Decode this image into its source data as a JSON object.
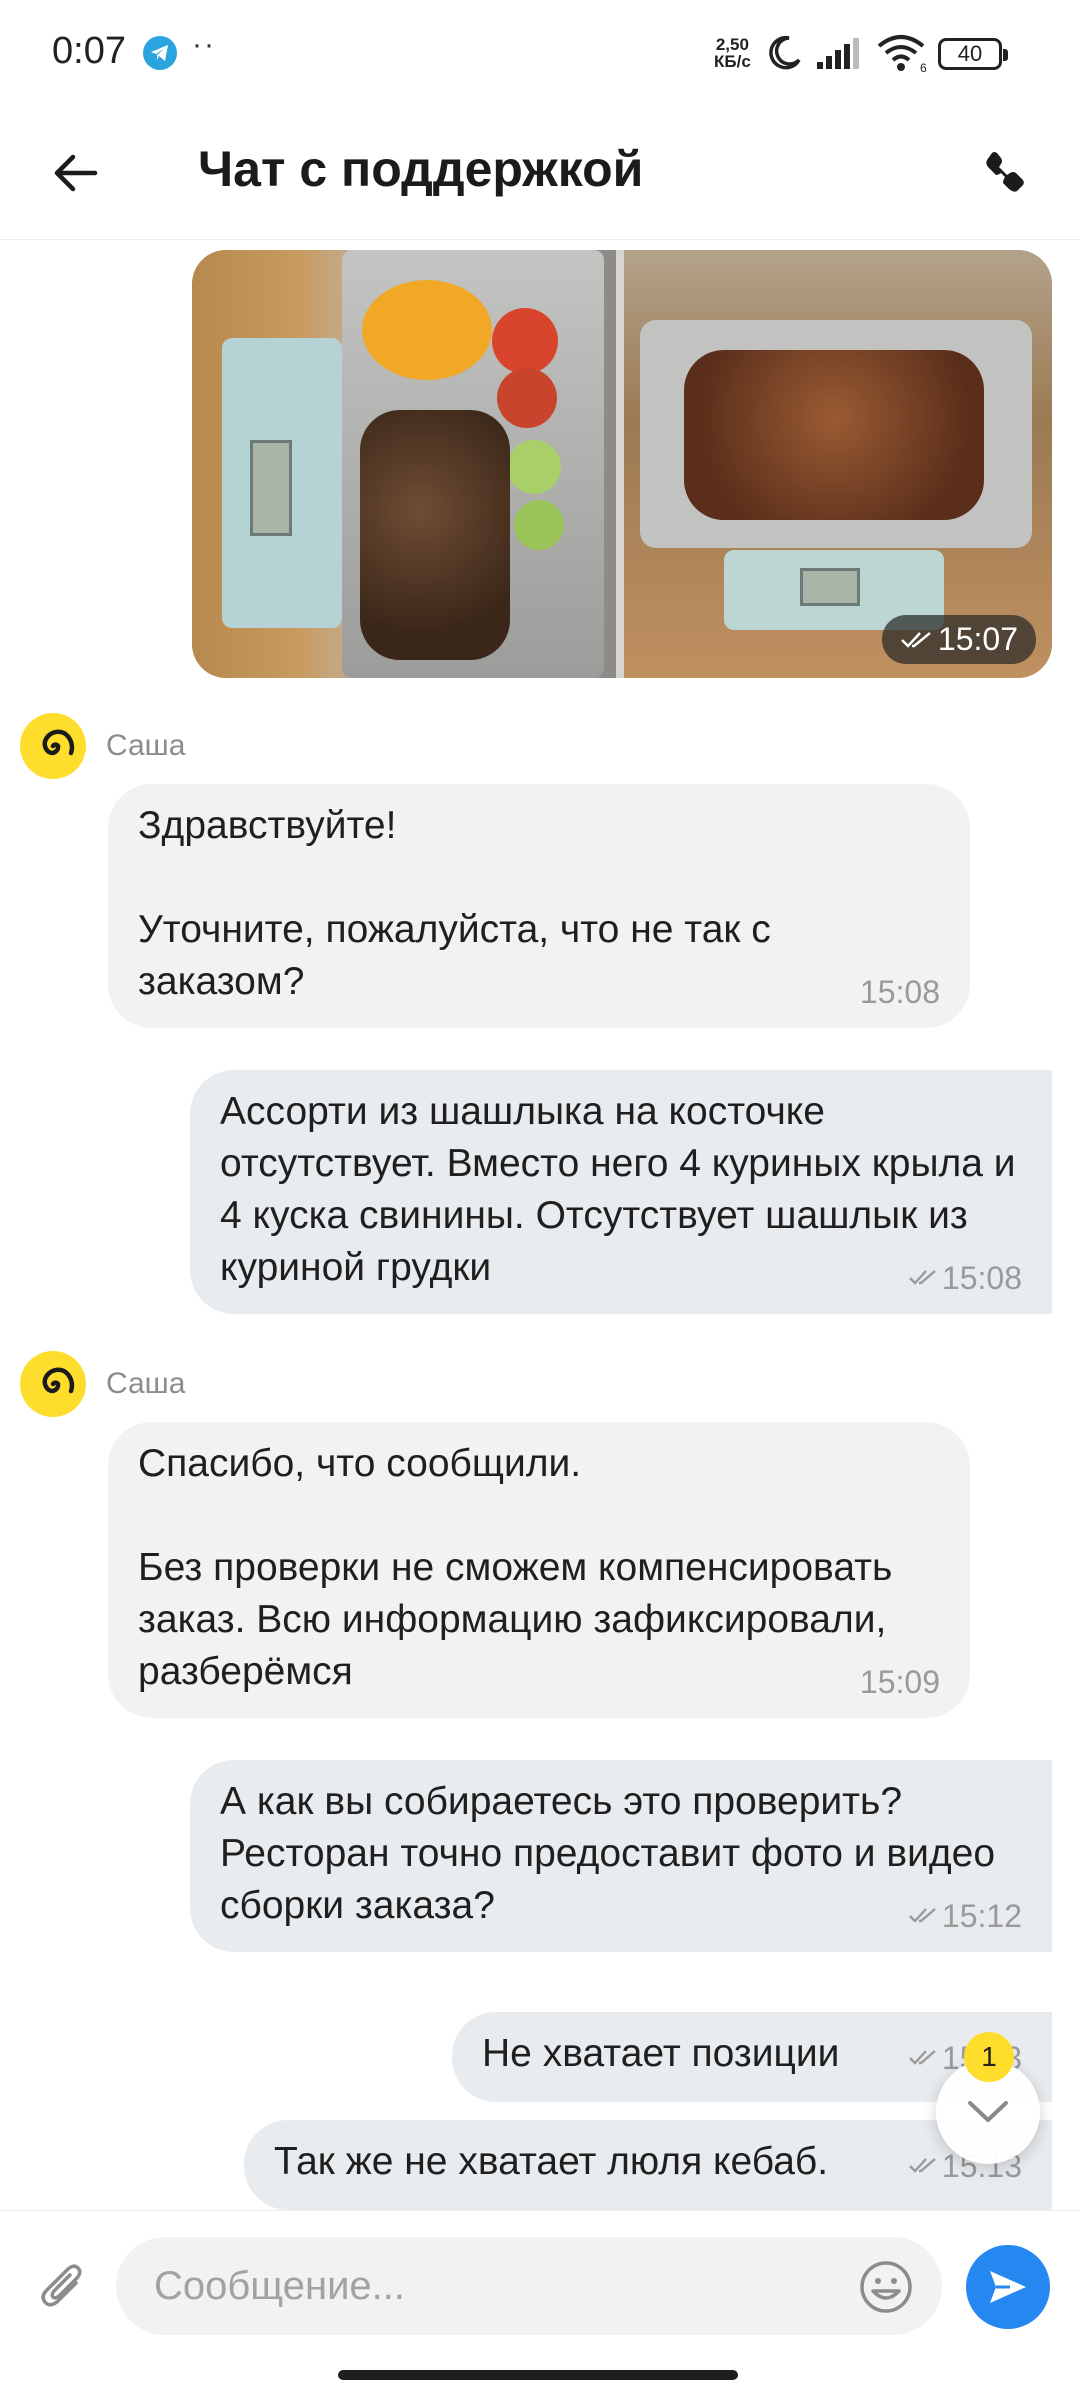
{
  "status_bar": {
    "time": "0:07",
    "dots": "··",
    "net_speed_value": "2,50",
    "net_speed_unit": "КБ/с",
    "battery": "40",
    "wifi_level": "6"
  },
  "header": {
    "title": "Чат с поддержкой"
  },
  "photo_message": {
    "time": "15:07",
    "left_scale_reading": "229",
    "right_scale_reading": "534"
  },
  "messages": [
    {
      "direction": "in",
      "sender": "Саша",
      "text": "Здравствуйте!\n\nУточните, пожалуйста, что не так с заказом?",
      "time": "15:08"
    },
    {
      "direction": "out",
      "text": "Ассорти из шашлыка на косточке отсутствует. Вместо него 4 куриных крыла и 4 куска свинины. Отсутствует шашлык из куриной грудки",
      "time": "15:08"
    },
    {
      "direction": "in",
      "sender": "Саша",
      "text": "Спасибо, что сообщили.\n\nБез проверки не сможем компенсировать заказ. Всю информацию зафиксировали, разберёмся",
      "time": "15:09"
    },
    {
      "direction": "out",
      "text": "А как вы собираетесь это проверить? Ресторан точно предоставит фото и видео сборки заказа?",
      "time": "15:12"
    },
    {
      "direction": "out",
      "text": "Не хватает позиции",
      "time": "15:13"
    },
    {
      "direction": "out",
      "text": "Так же не хватает люля кебаб.",
      "time": "15:13"
    }
  ],
  "scroll_down": {
    "unread_count": "1"
  },
  "composer": {
    "placeholder": "Сообщение..."
  },
  "colors": {
    "accent_yellow": "#ffdd2d",
    "send_blue": "#2488f0",
    "bubble_in": "#f2f2f3",
    "bubble_out": "#e8ecef"
  }
}
